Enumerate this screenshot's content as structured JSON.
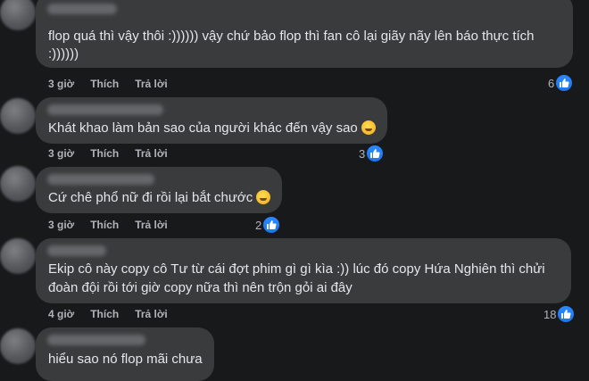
{
  "comments": [
    {
      "lines": [
        "flop quá thì vậy thôi :)))))) vậy chứ bảo flop thì fan cô lại giãy nãy lên báo thực tích",
        ":))))))"
      ],
      "emoji": null,
      "time": "3 giờ",
      "like_label": "Thích",
      "reply_label": "Trả lời",
      "reactions": "6"
    },
    {
      "lines": [
        "Khát khao làm bản sao của người khác đến vậy sao"
      ],
      "emoji": "smirk-emoji",
      "time": "3 giờ",
      "like_label": "Thích",
      "reply_label": "Trả lời",
      "reactions": "3"
    },
    {
      "lines": [
        "Cứ chê phổ nữ đi rồi lại bắt chước"
      ],
      "emoji": "grimace-emoji",
      "time": "3 giờ",
      "like_label": "Thích",
      "reply_label": "Trả lời",
      "reactions": "2"
    },
    {
      "lines": [
        "Ekip cô này copy cô Tư từ cái đợt phim gì gì kìa :)) lúc đó copy Hứa Nghiên thì chửi",
        "đoàn đội rồi tới giờ copy nữa thì nên trộn gỏi ai đây"
      ],
      "emoji": null,
      "time": "4 giờ",
      "like_label": "Thích",
      "reply_label": "Trả lời",
      "reactions": "18"
    },
    {
      "lines": [
        "hiểu sao nó flop mãi chưa"
      ],
      "emoji": null
    }
  ],
  "colors": {
    "background": "#18191a",
    "bubble": "#3a3b3c",
    "text": "#e4e6eb",
    "meta": "#b0b3b8",
    "like_blue": "#1877f2"
  },
  "icons": {
    "reaction": "like-thumb-icon"
  }
}
